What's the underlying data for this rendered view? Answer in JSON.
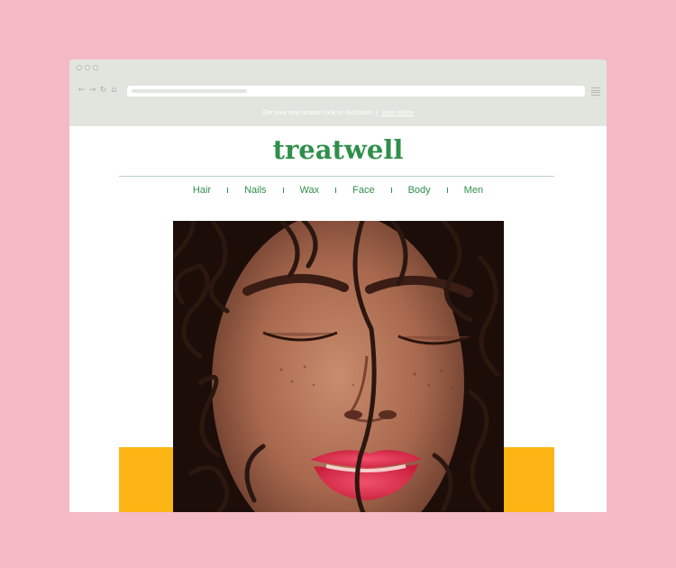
{
  "promo": {
    "text": "Get your new season look on lockdown",
    "separator": "|",
    "link_label": "View online"
  },
  "brand": {
    "logo_text": "treatwell",
    "color": "#2f8f4a"
  },
  "nav": {
    "items": [
      "Hair",
      "Nails",
      "Wax",
      "Face",
      "Body",
      "Men"
    ]
  },
  "colors": {
    "background": "#f4bac6",
    "accent": "#fdb515",
    "chrome": "#e2e4de"
  },
  "hero": {
    "image": "portrait-photo"
  }
}
